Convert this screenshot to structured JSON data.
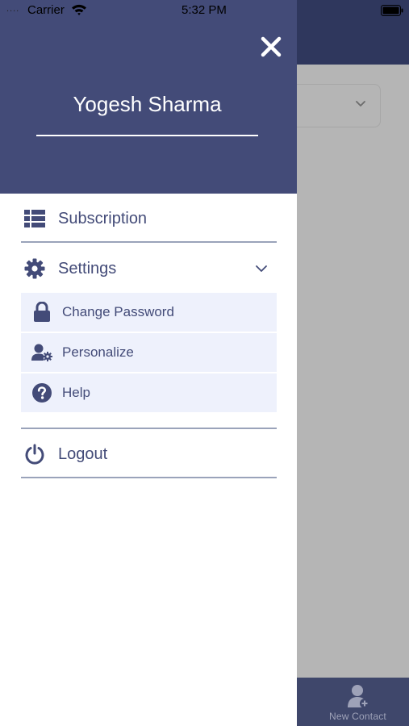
{
  "status_bar": {
    "signal": "....",
    "carrier": "Carrier",
    "time": "5:32 PM"
  },
  "drawer": {
    "user_name": "Yogesh Sharma",
    "close_icon": "close-icon",
    "menu": {
      "subscription": {
        "label": "Subscription",
        "icon": "list-icon"
      },
      "settings": {
        "label": "Settings",
        "icon": "gear-icon",
        "expanded": true,
        "submenu": [
          {
            "label": "Change Password",
            "icon": "lock-icon"
          },
          {
            "label": "Personalize",
            "icon": "user-gear-icon"
          },
          {
            "label": "Help",
            "icon": "question-circle-icon"
          }
        ]
      },
      "logout": {
        "label": "Logout",
        "icon": "power-icon"
      }
    }
  },
  "background": {
    "tabbar": {
      "new_contact_label": "New Contact",
      "icon": "add-contact-icon"
    }
  },
  "colors": {
    "drawer_header": "#434b78",
    "accent_text": "#434b78",
    "submenu_bg": "#eef1fc",
    "divider": "#9aa3ba",
    "app_header": "#2f375d",
    "overlay": "#b5b5b5"
  }
}
